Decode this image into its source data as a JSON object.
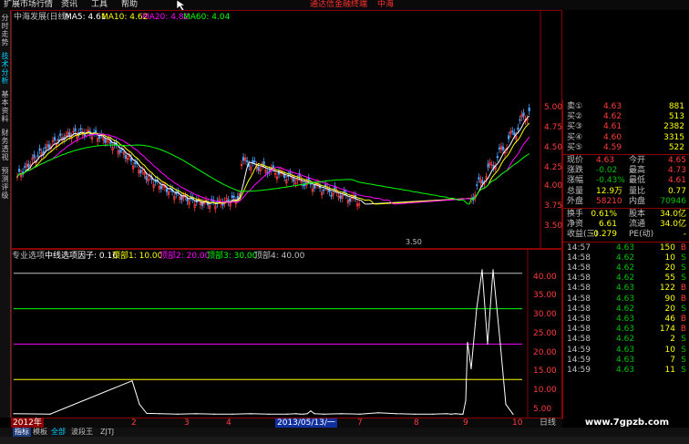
{
  "menu": {
    "items": [
      "扩展市场行情",
      "资讯",
      "工具",
      "帮助"
    ],
    "ad_text": "通达信金融终端",
    "ad_suffix": "中海"
  },
  "left_tabs": [
    "分时走势",
    "技术分析",
    "基本资料",
    "财务透视",
    "预测评级"
  ],
  "price_header": {
    "stock_name": "中海发展(日线)",
    "ma5_label": "MA5: 4.61",
    "ma10_label": "MA10: 4.62",
    "ma20_label": "MA20: 4.82",
    "ma60_label": "MA60: 4.04"
  },
  "price_axis": [
    "5.00",
    "4.75",
    "4.50",
    "4.25",
    "4.00",
    "3.75",
    "3.50"
  ],
  "price_low_label": "3.50",
  "indicator_header": {
    "panel_name": "专业选项",
    "formula": "中线选项因子: 0.16",
    "line1": "顶部1: 10.00",
    "line2": "顶部2: 20.00",
    "line3": "顶部3: 30.00",
    "line4": "顶部4: 40.00"
  },
  "indicator_axis": [
    "40.00",
    "35.00",
    "30.00",
    "25.00",
    "20.00",
    "15.00",
    "10.00",
    "5.00"
  ],
  "chart_data": {
    "type": "line",
    "series": [
      {
        "name": "中线选项因子",
        "values": [
          0.3,
          0.2,
          9.6,
          3.0,
          0.4,
          0.3,
          0.2,
          0.3,
          0.2,
          0.2,
          0.3,
          0.2,
          0.2,
          0.3,
          0.2,
          0.2,
          0.3,
          1.1,
          0.3,
          0.2,
          0.3,
          0.2,
          0.6,
          0.3,
          0.2,
          0.2,
          0.3,
          0.2,
          0.3,
          0.2,
          0.2,
          4.0,
          20.5,
          13.0,
          30.0,
          41.0,
          20.0,
          41.0,
          20.0,
          3.0,
          0.16
        ]
      }
    ],
    "reference_lines": [
      10,
      20,
      30,
      40
    ],
    "ylim": [
      0,
      42
    ]
  },
  "time_axis": [
    "2012年",
    "2",
    "3",
    "4",
    "5",
    "6",
    "7",
    "8",
    "9",
    "10"
  ],
  "time_cursor": "2013/05/13/一",
  "quote": {
    "asks": [
      {
        "label": "卖①",
        "price": "4.63",
        "vol": "881"
      },
      {
        "label": "买②",
        "price": "4.62",
        "vol": "513"
      },
      {
        "label": "买③",
        "price": "4.61",
        "vol": "2382"
      },
      {
        "label": "买④",
        "price": "4.60",
        "vol": "3315"
      },
      {
        "label": "买⑤",
        "price": "4.59",
        "vol": "522"
      }
    ],
    "stats": [
      {
        "l1": "现价",
        "v1": "4.63",
        "l2": "今开",
        "v2": "4.65"
      },
      {
        "l1": "涨跌",
        "v1": "-0.02",
        "l2": "最高",
        "v2": "4.73"
      },
      {
        "l1": "涨幅",
        "v1": "-0.43%",
        "l2": "最低",
        "v2": "4.61"
      },
      {
        "l1": "总量",
        "v1": "12.9万",
        "l2": "量比",
        "v2": "0.77"
      },
      {
        "l1": "外盘",
        "v1": "58210",
        "l2": "内盘",
        "v2": "70946"
      }
    ],
    "stats2": [
      {
        "l1": "换手",
        "v1": "0.61%",
        "l2": "股本",
        "v2": "34.0亿"
      },
      {
        "l1": "净资",
        "v1": "6.61",
        "l2": "流通",
        "v2": "34.0亿"
      },
      {
        "l1": "收益(三)",
        "v1": "-0.279",
        "l2": "PE(动)",
        "v2": "-"
      }
    ],
    "ticks": [
      {
        "t": "14:57",
        "p": "4.63",
        "v": "150",
        "s": "B"
      },
      {
        "t": "14:58",
        "p": "4.62",
        "v": "10",
        "s": "S"
      },
      {
        "t": "14:58",
        "p": "4.62",
        "v": "20",
        "s": "S"
      },
      {
        "t": "14:58",
        "p": "4.62",
        "v": "55",
        "s": "S"
      },
      {
        "t": "14:58",
        "p": "4.63",
        "v": "122",
        "s": "B"
      },
      {
        "t": "14:58",
        "p": "4.63",
        "v": "90",
        "s": "B"
      },
      {
        "t": "14:58",
        "p": "4.62",
        "v": "20",
        "s": "S"
      },
      {
        "t": "14:58",
        "p": "4.63",
        "v": "46",
        "s": "B"
      },
      {
        "t": "14:58",
        "p": "4.63",
        "v": "174",
        "s": "B"
      },
      {
        "t": "14:58",
        "p": "4.62",
        "v": "2",
        "s": "S"
      },
      {
        "t": "14:59",
        "p": "4.63",
        "v": "10",
        "s": "S"
      },
      {
        "t": "14:59",
        "p": "4.63",
        "v": "7",
        "s": "S"
      },
      {
        "t": "14:59",
        "p": "4.63",
        "v": "11",
        "s": "S"
      }
    ]
  },
  "bottom_tabs": [
    "指标",
    "模板",
    "全部",
    "波段王",
    "ZJTJ"
  ],
  "period_label": "日线",
  "watermark": "www.7gpzb.com",
  "colors": {
    "up": "#ff3c3c",
    "down": "#00c000",
    "ma5": "#ffffff",
    "ma10": "#ffff00",
    "ma20": "#ff00ff",
    "ma60": "#00ff00",
    "border": "#8b0000"
  }
}
